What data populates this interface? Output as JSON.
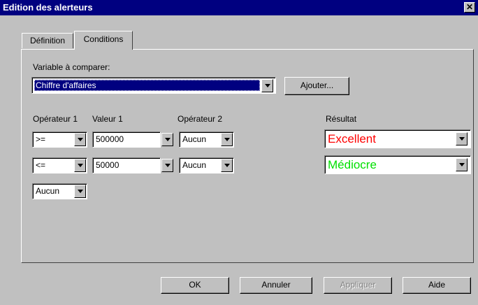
{
  "window": {
    "title": "Edition des alerteurs",
    "close_glyph": "✕"
  },
  "tabs": [
    {
      "label": "Définition"
    },
    {
      "label": "Conditions"
    }
  ],
  "variable": {
    "label": "Variable à comparer:",
    "value": "Chiffre d'affaires",
    "add_button": "Ajouter..."
  },
  "headers": {
    "op1": "Opérateur 1",
    "val1": "Valeur 1",
    "op2": "Opérateur 2",
    "result": "Résultat"
  },
  "rows": [
    {
      "op1": ">=",
      "val1": "500000",
      "op2": "Aucun",
      "result": "Excellent",
      "result_color": "#ff0000"
    },
    {
      "op1": "<=",
      "val1": "50000",
      "op2": "Aucun",
      "result": "Médiocre",
      "result_color": "#00e000"
    },
    {
      "op1": "Aucun"
    }
  ],
  "buttons": {
    "ok": "OK",
    "cancel": "Annuler",
    "apply": "Appliquer",
    "help": "Aide"
  }
}
